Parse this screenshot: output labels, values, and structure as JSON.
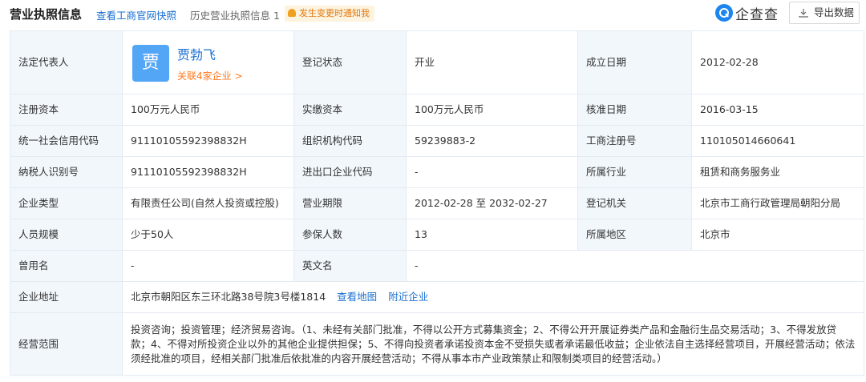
{
  "header": {
    "title": "营业执照信息",
    "snapshot_link": "查看工商官网快照",
    "history_label": "历史营业执照信息",
    "history_count": "1",
    "notify_label": "发生变更时通知我",
    "logo_text": "企查查",
    "export_label": "导出数据"
  },
  "rows": {
    "legal_rep": {
      "label": "法定代表人",
      "avatar_char": "贾",
      "name": "贾勃飞",
      "related": "关联4家企业 >"
    },
    "reg_status": {
      "label": "登记状态",
      "value": "开业"
    },
    "founded": {
      "label": "成立日期",
      "value": "2012-02-28"
    },
    "reg_capital": {
      "label": "注册资本",
      "value": "100万元人民币"
    },
    "paid_capital": {
      "label": "实缴资本",
      "value": "100万元人民币"
    },
    "approval_date": {
      "label": "核准日期",
      "value": "2016-03-15"
    },
    "credit_code": {
      "label": "统一社会信用代码",
      "value": "91110105592398832H"
    },
    "org_code": {
      "label": "组织机构代码",
      "value": "59239883-2"
    },
    "biz_reg_no": {
      "label": "工商注册号",
      "value": "110105014660641"
    },
    "taxpayer_id": {
      "label": "纳税人识别号",
      "value": "91110105592398832H"
    },
    "import_export": {
      "label": "进出口企业代码",
      "value": "-"
    },
    "industry": {
      "label": "所属行业",
      "value": "租赁和商务服务业"
    },
    "company_type": {
      "label": "企业类型",
      "value": "有限责任公司(自然人投资或控股)"
    },
    "biz_term": {
      "label": "营业期限",
      "value": "2012-02-28 至 2032-02-27"
    },
    "reg_authority": {
      "label": "登记机关",
      "value": "北京市工商行政管理局朝阳分局"
    },
    "staff_size": {
      "label": "人员规模",
      "value": "少于50人"
    },
    "insured": {
      "label": "参保人数",
      "value": "13"
    },
    "region": {
      "label": "所属地区",
      "value": "北京市"
    },
    "former_name": {
      "label": "曾用名",
      "value": "-"
    },
    "english_name": {
      "label": "英文名",
      "value": "-"
    },
    "address": {
      "label": "企业地址",
      "value": "北京市朝阳区东三环北路38号院3号楼1814",
      "map_link": "查看地图",
      "nearby_link": "附近企业"
    },
    "scope": {
      "label": "经营范围",
      "value": "投资咨询；投资管理；经济贸易咨询。（1、未经有关部门批准，不得以公开方式募集资金；2、不得公开开展证券类产品和金融衍生品交易活动；3、不得发放贷款；4、不得对所投资企业以外的其他企业提供担保；5、不得向投资者承诺投资本金不受损失或者承诺最低收益；企业依法自主选择经营项目，开展经营活动；依法须经批准的项目，经相关部门批准后依批准的内容开展经营活动；不得从事本市产业政策禁止和限制类项目的经营活动。）"
    }
  },
  "colors": {
    "label_bg": "#f2f7fc",
    "border": "#e4eaf2",
    "link": "#1a6fd1",
    "accent_orange": "#ff7a20",
    "avatar_bg": "#53a6f5"
  }
}
